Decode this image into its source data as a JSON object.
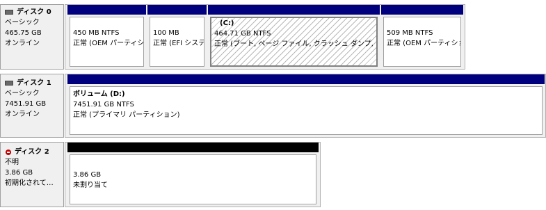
{
  "disks": [
    {
      "name": "ディスク 0",
      "type": "ベーシック",
      "size": "465.75 GB",
      "status": "オンライン",
      "partitions": [
        {
          "label": "",
          "size": "450 MB NTFS",
          "status": "正常 (OEM パーティション)"
        },
        {
          "label": "",
          "size": "100 MB",
          "status": "正常 (EFI システム パーティション)"
        },
        {
          "label": "(C:)",
          "size": "464.71 GB NTFS",
          "status": "正常 (ブート, ページ ファイル, クラッシュ ダンプ, プライマリ パーティション)"
        },
        {
          "label": "",
          "size": "509 MB NTFS",
          "status": "正常 (OEM パーティション)"
        }
      ]
    },
    {
      "name": "ディスク 1",
      "type": "ベーシック",
      "size": "7451.91 GB",
      "status": "オンライン",
      "partitions": [
        {
          "label": "ボリューム (D:)",
          "size": "7451.91 GB NTFS",
          "status": "正常 (プライマリ パーティション)"
        }
      ]
    },
    {
      "name": "ディスク 2",
      "type": "不明",
      "size": "3.86 GB",
      "status": "初期化されて…",
      "partitions": [
        {
          "label": "",
          "size": "3.86 GB",
          "status": "未割り当て"
        }
      ]
    }
  ],
  "colors": {
    "primary_bar": "#00007f",
    "unallocated_bar": "#000000",
    "unknown_disk_icon": "#c00000",
    "selected_hatch": "#b8b8b8"
  },
  "icons": {
    "disk0": "drive-icon",
    "disk1": "drive-icon",
    "disk2": "unknown-disk-icon"
  }
}
